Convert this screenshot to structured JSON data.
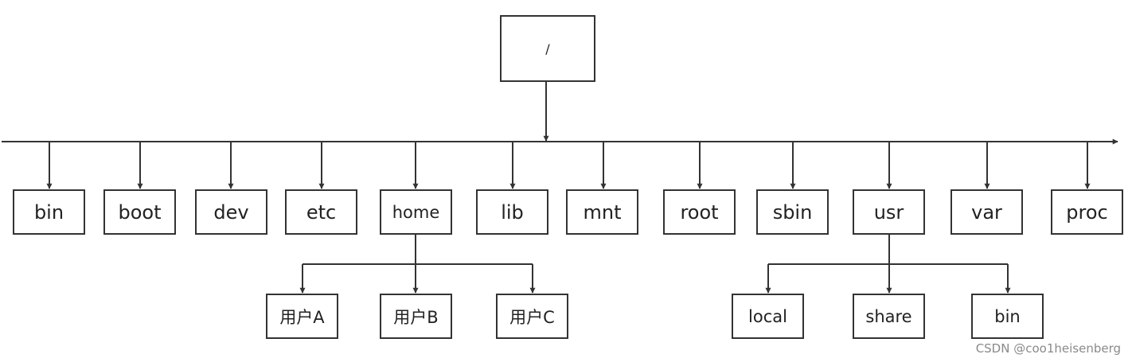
{
  "diagram": {
    "root": "/",
    "level1": [
      "bin",
      "boot",
      "dev",
      "etc",
      "home",
      "lib",
      "mnt",
      "root",
      "sbin",
      "usr",
      "var",
      "proc"
    ],
    "home_children": [
      "用户A",
      "用户B",
      "用户C"
    ],
    "usr_children": [
      "local",
      "share",
      "bin"
    ],
    "line_color": "#333333",
    "box_border_color": "#333333"
  },
  "watermark": "CSDN @coo1heisenberg"
}
